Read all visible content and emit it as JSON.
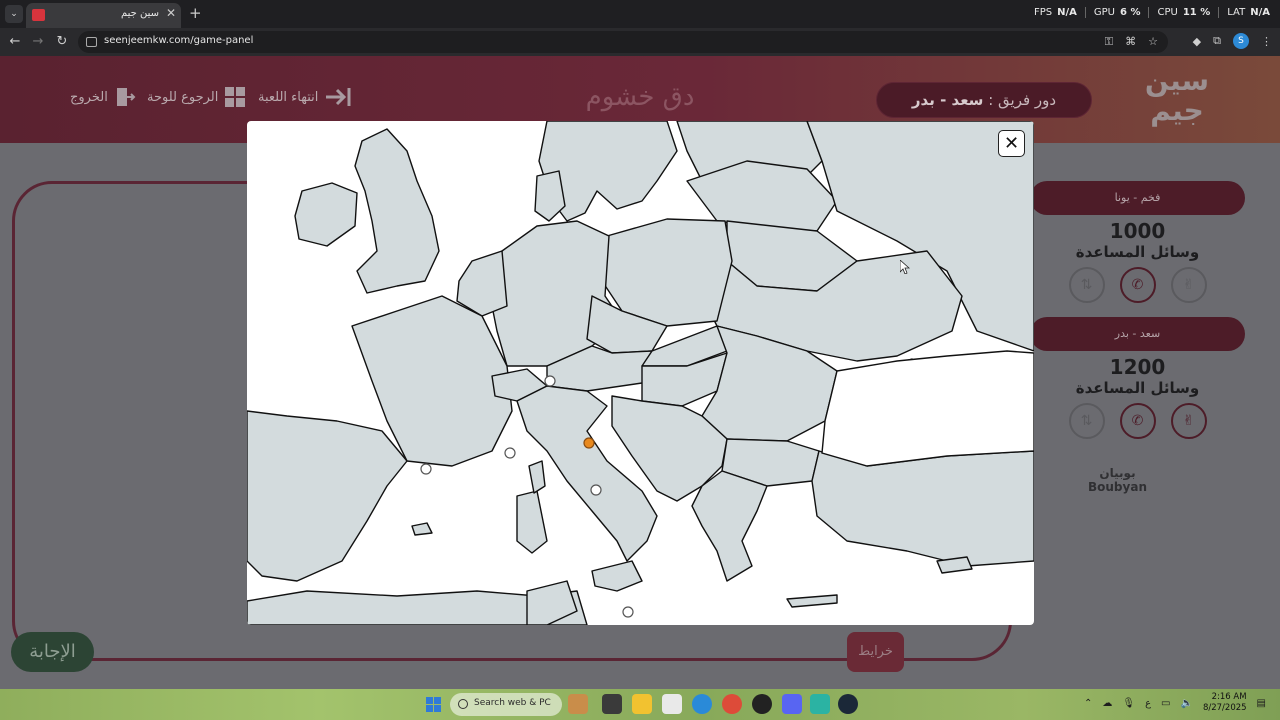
{
  "browser": {
    "tab_title": "سين جيم",
    "url": "seenjeemkw.com/game-panel",
    "profile_initial": "S",
    "perf": [
      {
        "label": "FPS",
        "value": "N/A"
      },
      {
        "label": "GPU",
        "value": "6 %"
      },
      {
        "label": "CPU",
        "value": "11 %"
      },
      {
        "label": "LAT",
        "value": "N/A"
      }
    ]
  },
  "header": {
    "exit_label": "الخروج",
    "back_to_board_label": "الرجوع للوحة",
    "end_game_label": "انتهاء اللعبة",
    "game_title": "دق خشوم",
    "turn_prefix": "دور فريق :",
    "turn_team": "سعد - بدر",
    "logo_line1": "سين",
    "logo_line2": "جيم"
  },
  "teams": [
    {
      "name": "فخم - يونا",
      "score": "1000",
      "aids_label": "وسائل المساعدة"
    },
    {
      "name": "سعد - بدر",
      "score": "1200",
      "aids_label": "وسائل المساعدة"
    }
  ],
  "sponsor": {
    "arabic": "بوبيان",
    "latin": "Boubyan"
  },
  "buttons": {
    "answer": "الإجابة",
    "maps": "خرايط",
    "close": "✕"
  },
  "taskbar": {
    "search_placeholder": "Search web & PC",
    "time": "2:16 AM",
    "date": "8/27/2025",
    "lang": "ع"
  },
  "colors": {
    "accent_maroon": "#4d1c28",
    "map_land": "#d3dbdd",
    "map_sea": "#ffffff",
    "marker": "#e8891e"
  },
  "icons": {
    "exit": "exit-door-icon",
    "board": "grid-icon",
    "end": "arrow-right-to-line-icon",
    "aid1": "swap-icon",
    "aid2": "phone-icon",
    "aid3": "victory-hand-icon"
  }
}
